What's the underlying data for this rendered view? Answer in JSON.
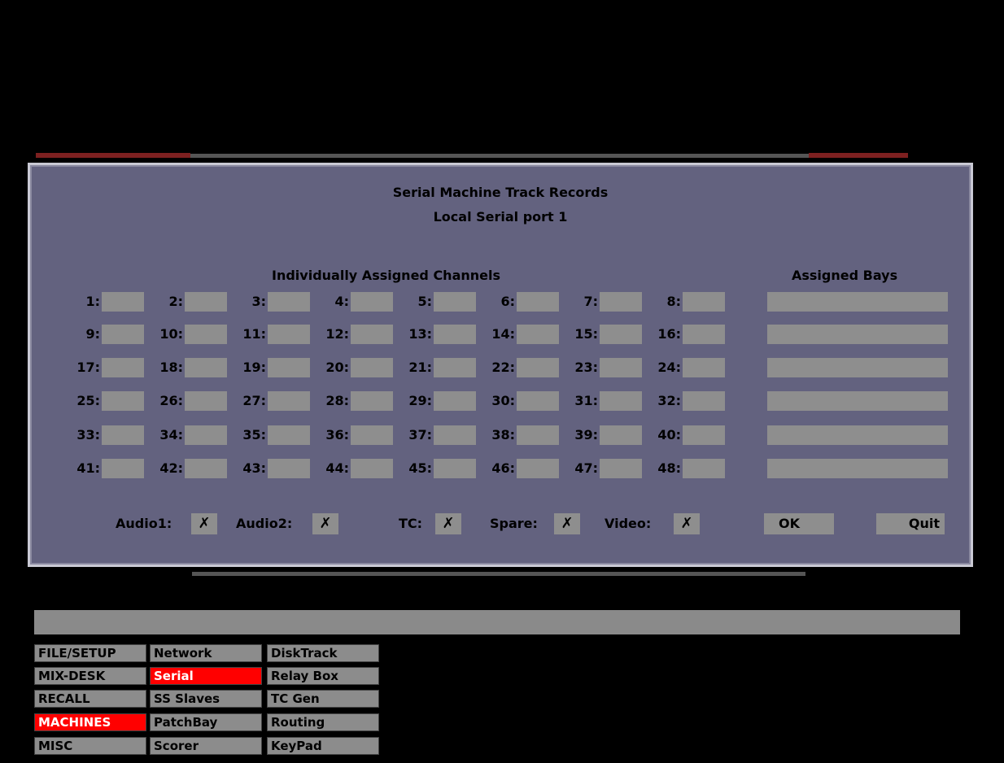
{
  "dialog": {
    "title": "Serial Machine Track Records",
    "subtitle": "Local Serial port 1",
    "channels_heading": "Individually Assigned Channels",
    "bays_heading": "Assigned Bays",
    "channels": [
      "1:",
      "2:",
      "3:",
      "4:",
      "5:",
      "6:",
      "7:",
      "8:",
      "9:",
      "10:",
      "11:",
      "12:",
      "13:",
      "14:",
      "15:",
      "16:",
      "17:",
      "18:",
      "19:",
      "20:",
      "21:",
      "22:",
      "23:",
      "24:",
      "25:",
      "26:",
      "27:",
      "28:",
      "29:",
      "30:",
      "31:",
      "32:",
      "33:",
      "34:",
      "35:",
      "36:",
      "37:",
      "38:",
      "39:",
      "40:",
      "41:",
      "42:",
      "43:",
      "44:",
      "45:",
      "46:",
      "47:",
      "48:"
    ],
    "checks": [
      {
        "label": "Audio1:",
        "value": "✗"
      },
      {
        "label": "Audio2:",
        "value": "✗"
      },
      {
        "label": "TC:",
        "value": "✗"
      },
      {
        "label": "Spare:",
        "value": "✗"
      },
      {
        "label": "Video:",
        "value": "✗"
      }
    ],
    "ok_label": "OK",
    "quit_label": "Quit"
  },
  "menu": {
    "col1": [
      "FILE/SETUP",
      "MIX-DESK",
      "RECALL",
      "MACHINES",
      "MISC"
    ],
    "col2": [
      "Network",
      "Serial",
      "SS Slaves",
      "PatchBay",
      "Scorer"
    ],
    "col3": [
      "DiskTrack",
      "Relay Box",
      "TC Gen",
      "Routing",
      "KeyPad"
    ],
    "active_col1": "MACHINES",
    "active_col2": "Serial"
  },
  "colors": {
    "dialog_bg": "#63627f",
    "field_grey": "#8e8e8e",
    "active_red": "#ff0000"
  }
}
